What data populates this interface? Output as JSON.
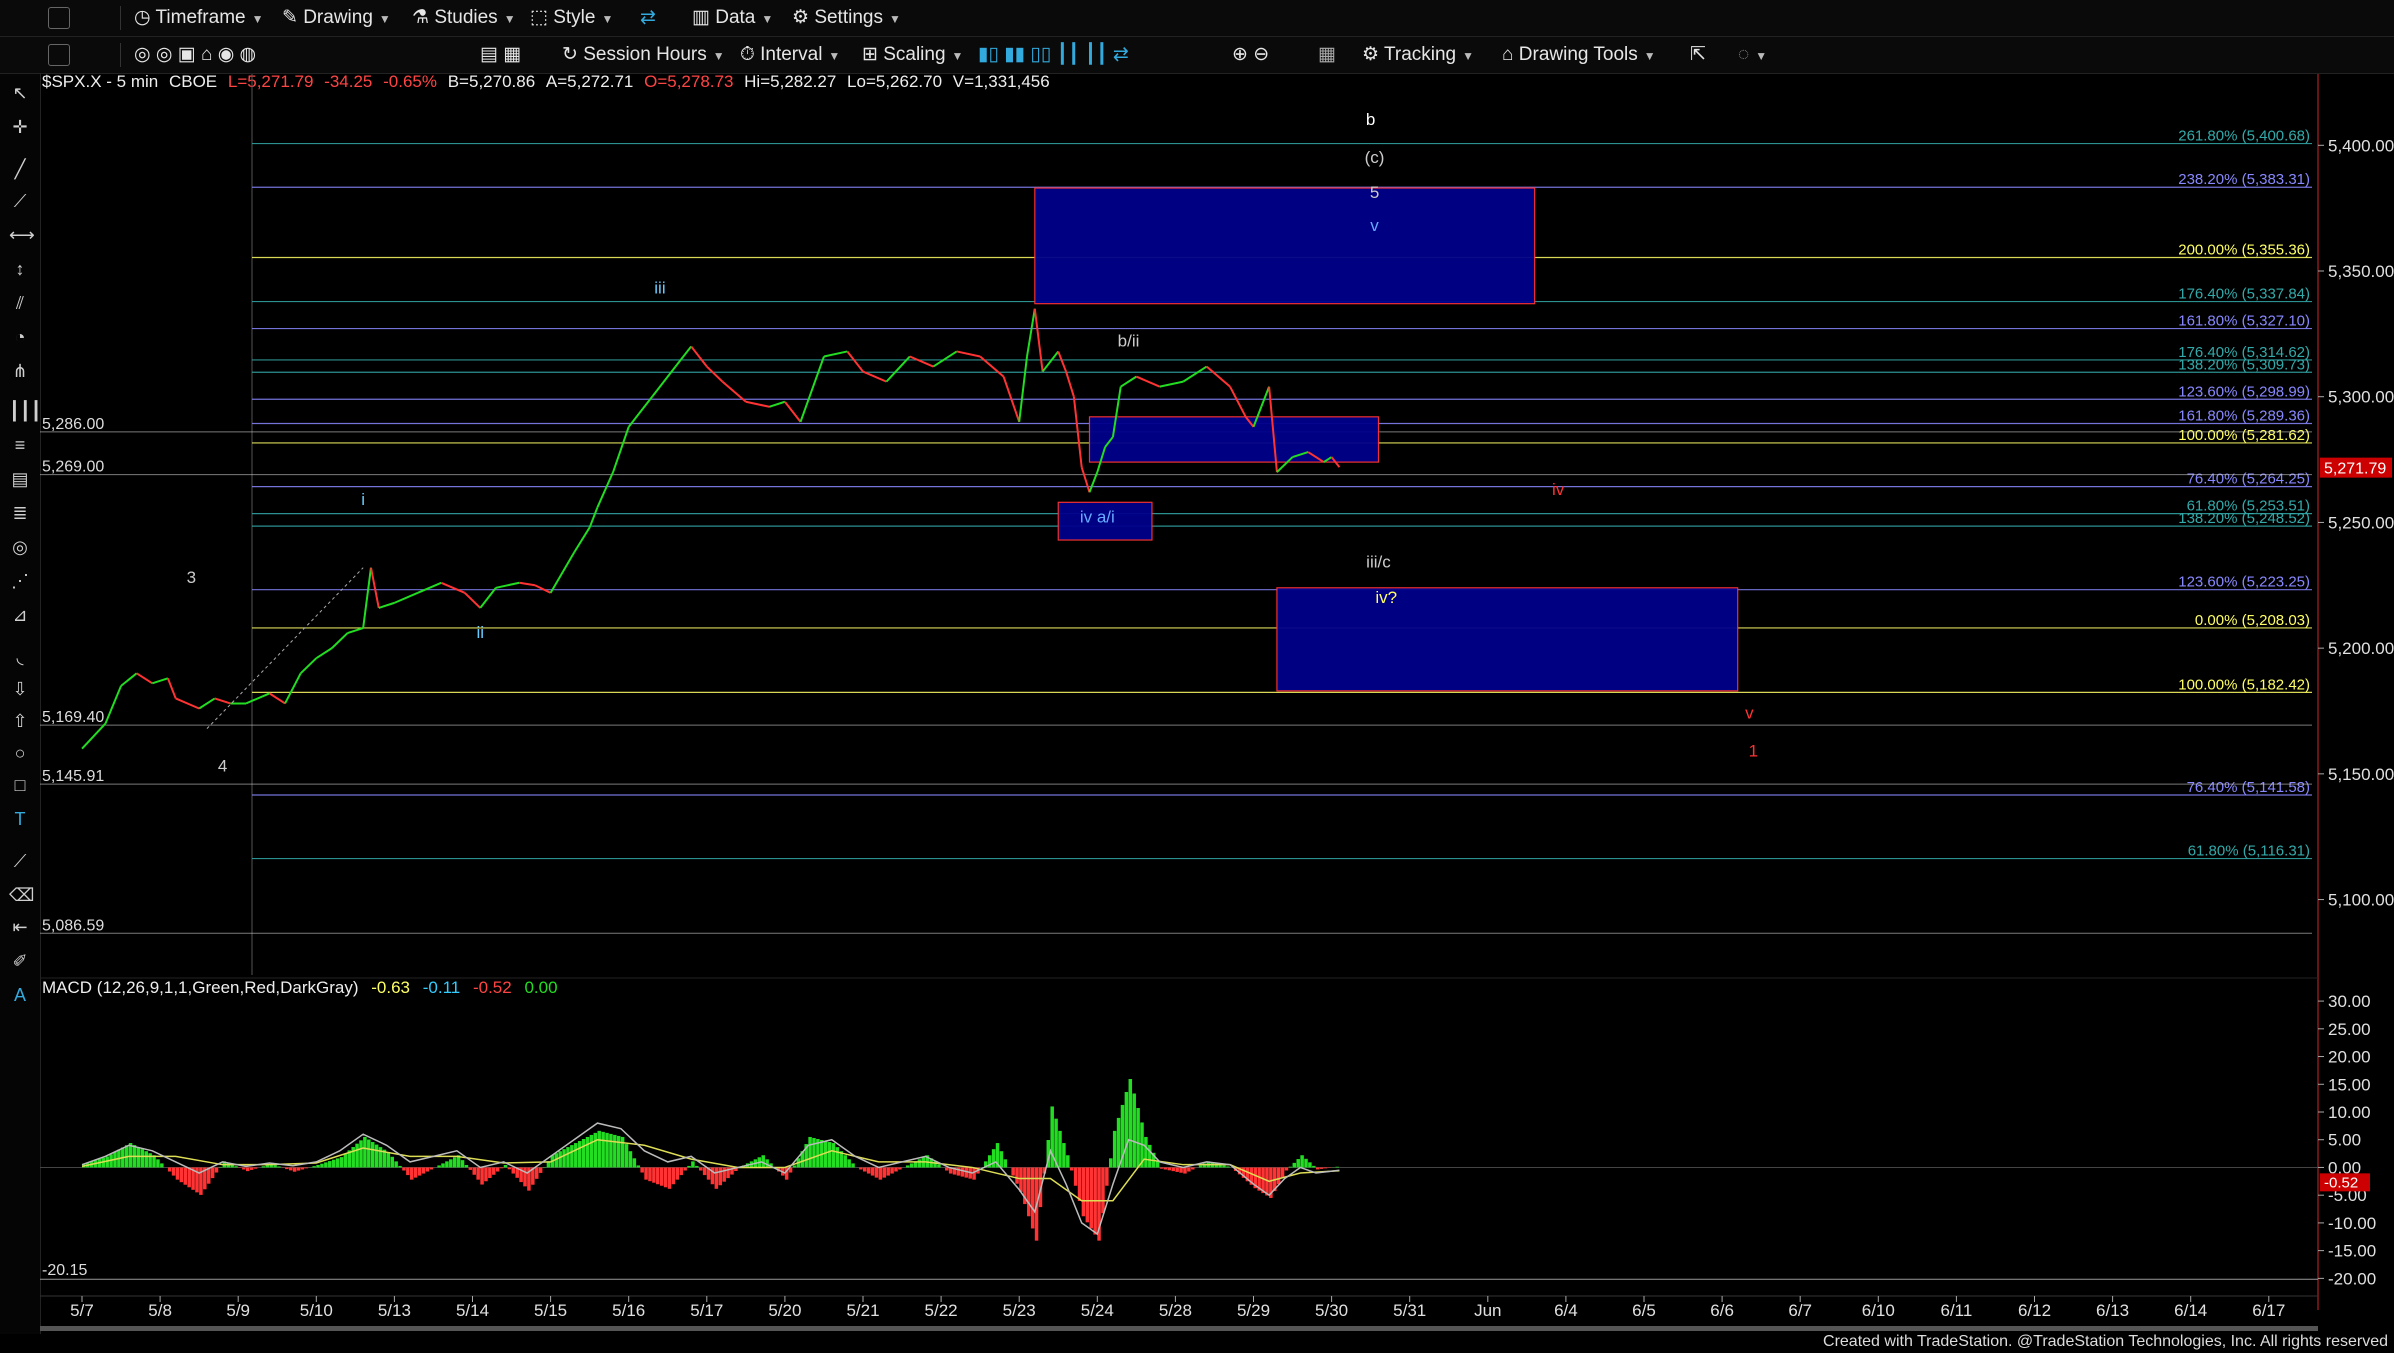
{
  "toolbar1": {
    "timeframe": "Timeframe",
    "drawing": "Drawing",
    "studies": "Studies",
    "style": "Style",
    "data": "Data",
    "settings": "Settings"
  },
  "toolbar2": {
    "session_hours": "Session Hours",
    "interval": "Interval",
    "scaling": "Scaling",
    "tracking": "Tracking",
    "drawing_tools": "Drawing Tools"
  },
  "symbol": {
    "name": "$SPX.X - 5 min",
    "exchange": "CBOE",
    "last": "L=5,271.79",
    "change": "-34.25",
    "pct": "-0.65%",
    "bid": "B=5,270.86",
    "ask": "A=5,272.71",
    "open": "O=5,278.73",
    "high": "Hi=5,282.27",
    "low": "Lo=5,262.70",
    "volume": "V=1,331,456"
  },
  "macd": {
    "label": "MACD (12,26,9,1,1,Green,Red,DarkGray)",
    "v1": "-0.63",
    "v2": "-0.11",
    "v3": "-0.52",
    "v4": "0.00"
  },
  "footer": "Created with TradeStation. @TradeStation Technologies, Inc. All rights reserved",
  "colors": {
    "up": "#22dd22",
    "down": "#ff3333",
    "box": "#00008b",
    "fib_purple": "#8888ff",
    "fib_yellow": "#ffff66",
    "fib_teal": "#33aaaa"
  },
  "chart_data": {
    "type": "line",
    "price_axis": [
      "5,400.00",
      "5,350.00",
      "5,300.00",
      "5,250.00",
      "5,200.00",
      "5,150.00",
      "5,100.00"
    ],
    "price_values": [
      5400,
      5350,
      5300,
      5250,
      5200,
      5150,
      5100
    ],
    "ylim": [
      5070,
      5420
    ],
    "last_price_tag": "5,271.79",
    "macd_axis": [
      "30.00",
      "25.00",
      "20.00",
      "15.00",
      "10.00",
      "5.00",
      "0.00",
      "-5.00",
      "-10.00",
      "-15.00",
      "-20.00"
    ],
    "macd_values": [
      30,
      25,
      20,
      15,
      10,
      5,
      0,
      -5,
      -10,
      -15,
      -20
    ],
    "macd_ylim": [
      -23,
      32
    ],
    "macd_tag": "-0.52",
    "macd_left_label": "-20.15",
    "dates": [
      "5/7",
      "5/8",
      "5/9",
      "5/10",
      "5/13",
      "5/14",
      "5/15",
      "5/16",
      "5/17",
      "5/20",
      "5/21",
      "5/22",
      "5/23",
      "5/24",
      "5/28",
      "5/29",
      "5/30",
      "5/31",
      "Jun",
      "6/4",
      "6/5",
      "6/6",
      "6/7",
      "6/10",
      "6/11",
      "6/12",
      "6/13",
      "6/14",
      "6/17"
    ],
    "fib_levels": [
      {
        "label": "261.80% (5,400.68)",
        "value": 5400.68,
        "color": "#33aaaa"
      },
      {
        "label": "238.20% (5,383.31)",
        "value": 5383.31,
        "color": "#8888ff"
      },
      {
        "label": "200.00% (5,355.36)",
        "value": 5355.36,
        "color": "#ffff66"
      },
      {
        "label": "176.40% (5,337.84)",
        "value": 5337.84,
        "color": "#33aaaa"
      },
      {
        "label": "161.80% (5,327.10)",
        "value": 5327.1,
        "color": "#8888ff"
      },
      {
        "label": "176.40% (5,314.62)",
        "value": 5314.62,
        "color": "#33aaaa"
      },
      {
        "label": "138.20% (5,309.73)",
        "value": 5309.73,
        "color": "#33aaaa"
      },
      {
        "label": "123.60% (5,298.99)",
        "value": 5298.99,
        "color": "#8888ff"
      },
      {
        "label": "161.80% (5,289.36)",
        "value": 5289.36,
        "color": "#8888ff"
      },
      {
        "label": "100.00% (5,281.62)",
        "value": 5281.62,
        "color": "#ffff66"
      },
      {
        "label": "76.40% (5,264.25)",
        "value": 5264.25,
        "color": "#8888ff"
      },
      {
        "label": "61.80% (5,253.51)",
        "value": 5253.51,
        "color": "#33aaaa"
      },
      {
        "label": "138.20% (5,248.52)",
        "value": 5248.52,
        "color": "#33aaaa"
      },
      {
        "label": "123.60% (5,223.25)",
        "value": 5223.25,
        "color": "#8888ff"
      },
      {
        "label": "0.00% (5,208.03)",
        "value": 5208.03,
        "color": "#ffff66"
      },
      {
        "label": "100.00% (5,182.42)",
        "value": 5182.42,
        "color": "#ffff66"
      },
      {
        "label": "76.40% (5,141.58)",
        "value": 5141.58,
        "color": "#8888ff"
      },
      {
        "label": "61.80% (5,116.31)",
        "value": 5116.31,
        "color": "#33aaaa"
      }
    ],
    "left_levels": [
      {
        "label": "5,286.00",
        "value": 5286.0
      },
      {
        "label": "5,269.00",
        "value": 5269.0
      },
      {
        "label": "5,169.40",
        "value": 5169.4
      },
      {
        "label": "5,145.91",
        "value": 5145.91
      },
      {
        "label": "5,086.59",
        "value": 5086.59
      }
    ],
    "target_boxes": [
      {
        "x0": 12.2,
        "x1": 18.6,
        "top": 5383,
        "bottom": 5337
      },
      {
        "x0": 12.9,
        "x1": 16.6,
        "top": 5292,
        "bottom": 5274
      },
      {
        "x0": 12.5,
        "x1": 13.7,
        "top": 5258,
        "bottom": 5243
      },
      {
        "x0": 15.3,
        "x1": 21.2,
        "top": 5224,
        "bottom": 5183
      }
    ],
    "wave_labels": [
      {
        "text": "b",
        "x": 16.5,
        "y": 5408,
        "color": "#ffffff"
      },
      {
        "text": "(c)",
        "x": 16.55,
        "y": 5393,
        "color": "#cccccc"
      },
      {
        "text": "5",
        "x": 16.55,
        "y": 5379,
        "color": "#cccccc"
      },
      {
        "text": "v",
        "x": 16.55,
        "y": 5366,
        "color": "#66aaff"
      },
      {
        "text": "iii",
        "x": 7.4,
        "y": 5341,
        "color": "#66ccff"
      },
      {
        "text": "b/ii",
        "x": 13.4,
        "y": 5320,
        "color": "#cccccc"
      },
      {
        "text": "i",
        "x": 3.6,
        "y": 5257,
        "color": "#66ccff"
      },
      {
        "text": "iv a/i",
        "x": 13.0,
        "y": 5250,
        "color": "#66aaff"
      },
      {
        "text": "iv",
        "x": 18.9,
        "y": 5261,
        "color": "#ff3333"
      },
      {
        "text": "3",
        "x": 1.4,
        "y": 5226,
        "color": "#cccccc"
      },
      {
        "text": "iii/c",
        "x": 16.6,
        "y": 5232,
        "color": "#cccccc"
      },
      {
        "text": "iv?",
        "x": 16.7,
        "y": 5218,
        "color": "#ffff66"
      },
      {
        "text": "ii",
        "x": 5.1,
        "y": 5204,
        "color": "#66ccff"
      },
      {
        "text": "4",
        "x": 1.8,
        "y": 5151,
        "color": "#cccccc"
      },
      {
        "text": "v",
        "x": 21.35,
        "y": 5172,
        "color": "#ff3333"
      },
      {
        "text": "1",
        "x": 21.4,
        "y": 5157,
        "color": "#ff3333"
      }
    ],
    "price_path": [
      [
        0.0,
        5160
      ],
      [
        0.3,
        5170
      ],
      [
        0.5,
        5185
      ],
      [
        0.7,
        5190
      ],
      [
        0.9,
        5186
      ],
      [
        1.1,
        5188
      ],
      [
        1.2,
        5180
      ],
      [
        1.5,
        5176
      ],
      [
        1.7,
        5180
      ],
      [
        1.9,
        5178
      ],
      [
        2.1,
        5178
      ],
      [
        2.4,
        5182
      ],
      [
        2.6,
        5178
      ],
      [
        2.8,
        5190
      ],
      [
        3.0,
        5196
      ],
      [
        3.2,
        5200
      ],
      [
        3.4,
        5206
      ],
      [
        3.6,
        5208
      ],
      [
        3.7,
        5232
      ],
      [
        3.8,
        5216
      ],
      [
        4.0,
        5218
      ],
      [
        4.3,
        5222
      ],
      [
        4.6,
        5226
      ],
      [
        4.9,
        5222
      ],
      [
        5.1,
        5216
      ],
      [
        5.3,
        5224
      ],
      [
        5.6,
        5226
      ],
      [
        5.8,
        5225
      ],
      [
        6.0,
        5222
      ],
      [
        6.3,
        5238
      ],
      [
        6.5,
        5248
      ],
      [
        6.6,
        5256
      ],
      [
        6.8,
        5270
      ],
      [
        7.0,
        5288
      ],
      [
        7.3,
        5300
      ],
      [
        7.6,
        5312
      ],
      [
        7.8,
        5320
      ],
      [
        8.0,
        5312
      ],
      [
        8.2,
        5306
      ],
      [
        8.5,
        5298
      ],
      [
        8.8,
        5296
      ],
      [
        9.0,
        5298
      ],
      [
        9.2,
        5290
      ],
      [
        9.5,
        5316
      ],
      [
        9.8,
        5318
      ],
      [
        10.0,
        5310
      ],
      [
        10.3,
        5306
      ],
      [
        10.6,
        5316
      ],
      [
        10.9,
        5312
      ],
      [
        11.2,
        5318
      ],
      [
        11.5,
        5316
      ],
      [
        11.8,
        5308
      ],
      [
        12.0,
        5290
      ],
      [
        12.1,
        5316
      ],
      [
        12.2,
        5335
      ],
      [
        12.3,
        5310
      ],
      [
        12.5,
        5318
      ],
      [
        12.6,
        5310
      ],
      [
        12.7,
        5300
      ],
      [
        12.8,
        5272
      ],
      [
        12.9,
        5262
      ],
      [
        13.0,
        5270
      ],
      [
        13.1,
        5280
      ],
      [
        13.2,
        5284
      ],
      [
        13.3,
        5304
      ],
      [
        13.5,
        5308
      ],
      [
        13.8,
        5304
      ],
      [
        14.1,
        5306
      ],
      [
        14.4,
        5312
      ],
      [
        14.7,
        5304
      ],
      [
        14.9,
        5292
      ],
      [
        15.0,
        5288
      ],
      [
        15.1,
        5296
      ],
      [
        15.2,
        5304
      ],
      [
        15.3,
        5270
      ],
      [
        15.5,
        5276
      ],
      [
        15.7,
        5278
      ],
      [
        15.9,
        5274
      ],
      [
        16.0,
        5276
      ],
      [
        16.1,
        5272
      ]
    ],
    "macd_path": [
      [
        0.0,
        0.5
      ],
      [
        0.3,
        2
      ],
      [
        0.6,
        4
      ],
      [
        0.9,
        3
      ],
      [
        1.2,
        1
      ],
      [
        1.5,
        -1
      ],
      [
        1.8,
        1
      ],
      [
        2.1,
        0.2
      ],
      [
        2.4,
        0.8
      ],
      [
        2.7,
        0.3
      ],
      [
        3.0,
        1
      ],
      [
        3.3,
        3
      ],
      [
        3.6,
        6
      ],
      [
        3.9,
        4
      ],
      [
        4.2,
        1
      ],
      [
        4.5,
        2
      ],
      [
        4.8,
        3
      ],
      [
        5.1,
        0
      ],
      [
        5.4,
        1
      ],
      [
        5.7,
        -1
      ],
      [
        6.0,
        2
      ],
      [
        6.3,
        5
      ],
      [
        6.6,
        8
      ],
      [
        6.9,
        7
      ],
      [
        7.2,
        3
      ],
      [
        7.5,
        1
      ],
      [
        7.8,
        2
      ],
      [
        8.1,
        -1
      ],
      [
        8.4,
        0
      ],
      [
        8.7,
        1
      ],
      [
        9.0,
        -1
      ],
      [
        9.3,
        4
      ],
      [
        9.6,
        5
      ],
      [
        9.9,
        2
      ],
      [
        10.2,
        0
      ],
      [
        10.5,
        1
      ],
      [
        10.8,
        2
      ],
      [
        11.1,
        0
      ],
      [
        11.4,
        -1
      ],
      [
        11.7,
        1
      ],
      [
        12.0,
        -4
      ],
      [
        12.2,
        -8
      ],
      [
        12.4,
        3
      ],
      [
        12.6,
        -3
      ],
      [
        12.8,
        -10
      ],
      [
        13.0,
        -12
      ],
      [
        13.2,
        -3
      ],
      [
        13.4,
        5
      ],
      [
        13.6,
        4
      ],
      [
        13.8,
        1
      ],
      [
        14.1,
        0
      ],
      [
        14.4,
        1
      ],
      [
        14.7,
        0.5
      ],
      [
        15.0,
        -3
      ],
      [
        15.2,
        -5
      ],
      [
        15.4,
        -2
      ],
      [
        15.6,
        0
      ],
      [
        15.8,
        -1
      ],
      [
        16.1,
        -0.5
      ]
    ],
    "signal_path": [
      [
        0.0,
        0.2
      ],
      [
        0.6,
        2
      ],
      [
        1.2,
        2
      ],
      [
        1.8,
        0.5
      ],
      [
        2.4,
        0.5
      ],
      [
        3.0,
        0.8
      ],
      [
        3.6,
        3.5
      ],
      [
        4.2,
        2
      ],
      [
        4.8,
        2
      ],
      [
        5.4,
        0.8
      ],
      [
        6.0,
        1
      ],
      [
        6.6,
        5
      ],
      [
        7.2,
        4
      ],
      [
        7.8,
        1.5
      ],
      [
        8.4,
        0
      ],
      [
        9.0,
        0
      ],
      [
        9.6,
        3
      ],
      [
        10.2,
        1
      ],
      [
        10.8,
        1
      ],
      [
        11.4,
        0
      ],
      [
        12.0,
        -2
      ],
      [
        12.4,
        -2
      ],
      [
        12.8,
        -6
      ],
      [
        13.2,
        -6
      ],
      [
        13.6,
        1.5
      ],
      [
        14.1,
        0.5
      ],
      [
        14.7,
        0.5
      ],
      [
        15.2,
        -2.5
      ],
      [
        15.6,
        -1
      ],
      [
        16.1,
        -0.6
      ]
    ]
  }
}
